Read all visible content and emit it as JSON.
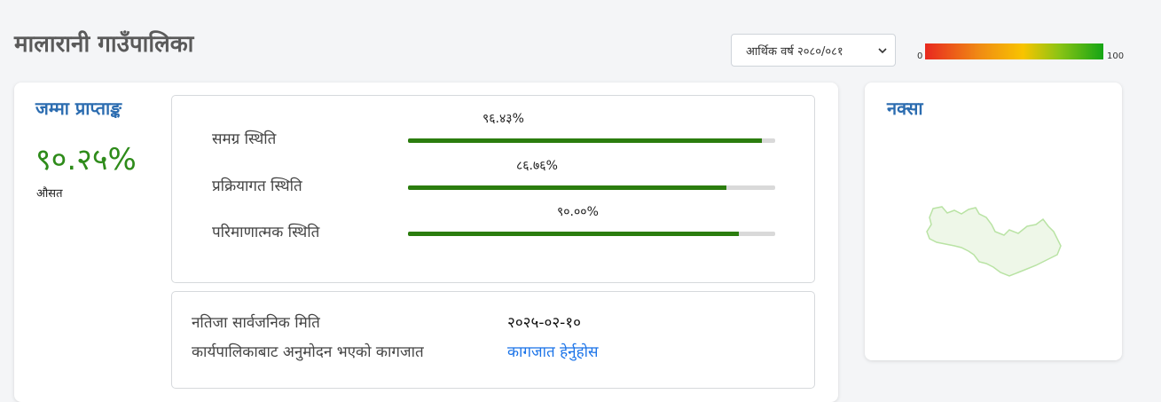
{
  "header": {
    "title": "मालारानी गाउँपालिका",
    "fiscal_year": "आर्थिक वर्ष २०८०/०८१",
    "legend_min": "0",
    "legend_max": "100"
  },
  "summary": {
    "title": "जम्मा प्राप्ताङ्क",
    "value": "९०.२५%",
    "subtitle": "औसत"
  },
  "status": [
    {
      "label": "समग्र स्थिति",
      "pct_text": "९६.४३%",
      "pct": 96.43
    },
    {
      "label": "प्रक्रियागत स्थिति",
      "pct_text": "८६.७६%",
      "pct": 86.76
    },
    {
      "label": "परिमाणात्मक स्थिति",
      "pct_text": "९०.००%",
      "pct": 90.0
    }
  ],
  "info": {
    "publish_label": "नतिजा सार्वजनिक मिति",
    "publish_date": "२०२५-०२-१०",
    "doc_label": "कार्यपालिकाबाट अनुमोदन भएको कागजात",
    "doc_link": "कागजात हेर्नुहोस"
  },
  "map": {
    "title": "नक्सा",
    "fill_color": "#eef7e8",
    "stroke_color": "#b9e3a4"
  },
  "colors": {
    "accent_blue": "#2b6cb0",
    "green": "#2e8b1a",
    "bar_fill": "#2b7d0e",
    "link": "#1a73e8"
  }
}
